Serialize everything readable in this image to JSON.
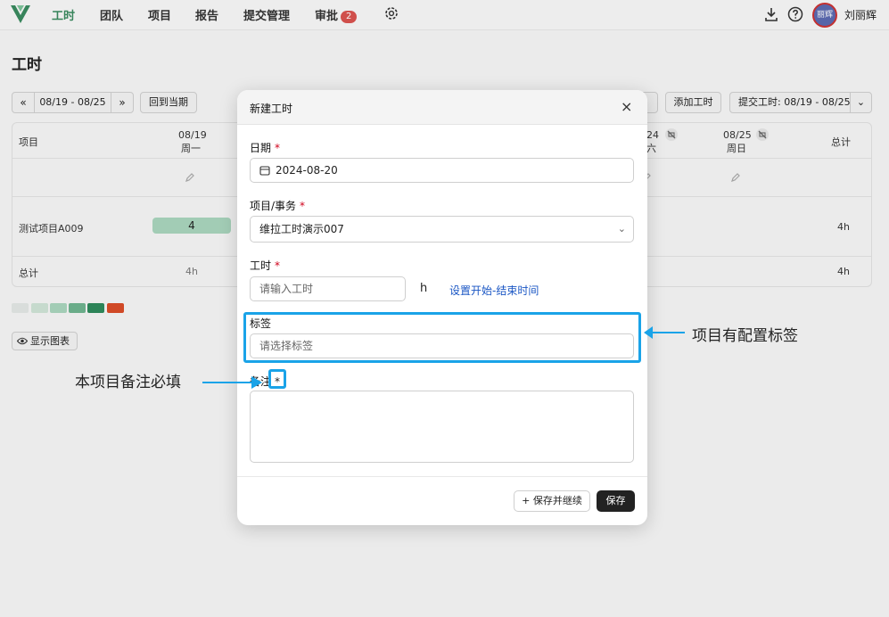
{
  "nav": {
    "items": [
      "工时",
      "团队",
      "项目",
      "报告",
      "提交管理",
      "审批"
    ],
    "approval_badge": "2",
    "username": "刘丽辉",
    "avatar_text": "丽辉"
  },
  "page": {
    "title": "工时",
    "week_range": "08/19 - 08/25",
    "back_to_current": "回到当期",
    "add_hours": "添加工时",
    "submit_hours": "提交工时: 08/19 - 08/25",
    "show_chart": "显示图表"
  },
  "table": {
    "col_project": "项目",
    "col_total": "总计",
    "day1_date": "08/19",
    "day1_week": "周一",
    "day6_date": "24",
    "day6_week": "六",
    "day7_date": "08/25",
    "day7_week": "周日",
    "project_name": "测试项目A009",
    "project_day1_hours": "4",
    "project_total": "4h",
    "total_label": "总计",
    "total_day1": "4h",
    "total_all": "4h"
  },
  "legend_colors": [
    "#e2e6e4",
    "#cfe3d6",
    "#a9d5bd",
    "#6fb48f",
    "#2f8a5c",
    "#d94c28"
  ],
  "modal": {
    "title": "新建工时",
    "date_label": "日期",
    "date_value": "2024-08-20",
    "project_label": "项目/事务",
    "project_value": "维拉工时演示007",
    "hours_label": "工时",
    "hours_placeholder": "请输入工时",
    "hours_unit": "h",
    "set_time_link": "设置开始-结束时间",
    "tag_label": "标签",
    "tag_placeholder": "请选择标签",
    "note_label": "备注",
    "required_mark": "*",
    "save_continue": "保存并继续",
    "save": "保存"
  },
  "annotations": {
    "tag_note": "项目有配置标签",
    "remark_note": "本项目备注必填"
  },
  "colors": {
    "accent": "#3a8a5f",
    "highlight": "#1aa3e8",
    "required": "#d0021b",
    "link": "#1a56c4"
  }
}
